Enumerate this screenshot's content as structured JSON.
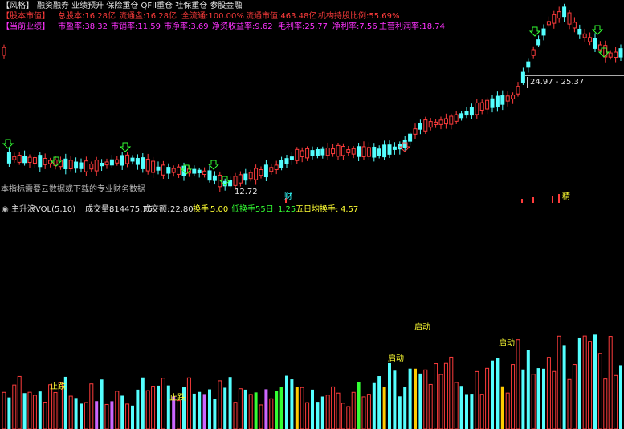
{
  "header": {
    "style_label": "【风格】",
    "style_tags": "融资融券 业绩预升 保险重仓 QFII重仓 社保重仓 参股金融",
    "capital_label": "【股本市值】",
    "capital_items": [
      "总股本:16.28亿",
      "流通盘:16.28亿",
      "全流通:100.00%",
      "流通市值:463.48亿",
      "机构持股比例:55.69%"
    ],
    "performance_label": "【当前业绩】",
    "performance_items": [
      "市盈率:38.32",
      "市销率:11.59",
      "市净率:3.69",
      "净资收益率:9.62",
      "毛利率:25.77",
      "净利率:7.56",
      "主营利润率:18.74"
    ]
  },
  "chart": {
    "notice": "本指标需要云数据或下载的专业财务数据",
    "low_label": "12.72",
    "fin_mark": "财",
    "range_label": "24.97 - 25.37",
    "fin_mark2": "精"
  },
  "indicator": {
    "name": "主升浪VOL(5,10)",
    "volume_label": "成交量:",
    "volume_value": "814475.75",
    "amount_label": "成交额:",
    "amount_value": "22.80",
    "turnover_label": "换手:",
    "turnover_value": "5.00",
    "low_turnover_label": "低换手55日:",
    "low_turnover_value": "1.25",
    "avg5_label": "五日均换手:",
    "avg5_value": "4.57"
  },
  "annotations": {
    "stop_fall_1": "止跌",
    "stop_fall_2": "止跌",
    "start_1": "启动",
    "start_2": "启动",
    "start_3": "启动"
  },
  "colors": {
    "up": "#ff3c3c",
    "down": "#54ffff",
    "start_bar": "#ffcc00",
    "stop_bar": "#cc66ff",
    "low_bar": "#33ff33"
  }
}
